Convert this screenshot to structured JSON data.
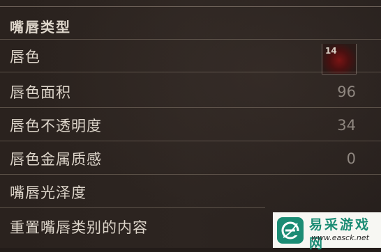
{
  "section": {
    "title": "嘴唇类型"
  },
  "rows": [
    {
      "label": "唇色",
      "value": "14"
    },
    {
      "label": "唇色面积",
      "value": "96"
    },
    {
      "label": "唇色不透明度",
      "value": "34"
    },
    {
      "label": "唇色金属质感",
      "value": "0"
    },
    {
      "label": "嘴唇光泽度",
      "value": ""
    },
    {
      "label": "重置嘴唇类别的内容",
      "value": ""
    }
  ],
  "swatch": {
    "color": "#7a1414"
  },
  "watermark": {
    "name": "易采游戏网",
    "url": "www.easck.net",
    "icon": "leaf-e-logo-icon",
    "color": "#1b8c74"
  }
}
